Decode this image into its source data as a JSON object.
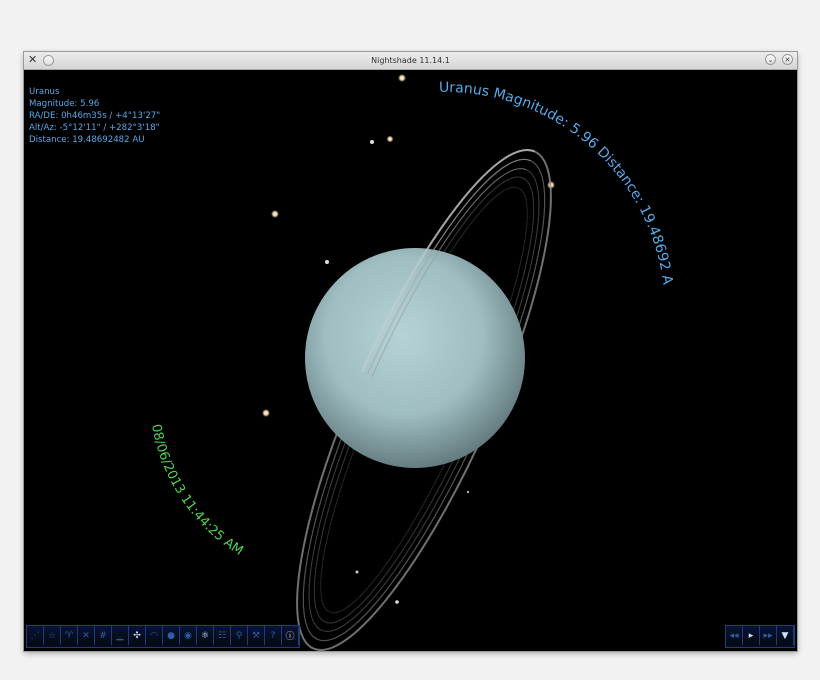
{
  "window": {
    "title": "Nightshade 11.14.1"
  },
  "object_info": {
    "name": "Uranus",
    "magnitude": "Magnitude: 5.96",
    "ra_de": "RA/DE: 0h46m35s / +4°13'27\"",
    "alt_az": "Alt/Az: -5°12'11\" / +282°3'18\"",
    "distance": "Distance: 19.48692482 AU"
  },
  "curved_label": "Uranus Magnitude: 5.96 Distance: 19.48692 AU",
  "datetime_label": "08/06/2013 11:44:25 AM",
  "colors": {
    "info_text": "#57a9e8",
    "date_text": "#4fd44f",
    "planet": "#9fbec2",
    "sky": "#000000"
  },
  "toolbar": {
    "left_icons": [
      "constellation-lines-icon",
      "constellation-names-icon",
      "constellation-art-icon",
      "azimuth-grid-icon",
      "equatorial-grid-icon",
      "ground-icon",
      "cardinal-points-icon",
      "atmosphere-icon",
      "nebula-icon",
      "planet-names-icon",
      "telescope-icon",
      "night-mode-icon",
      "search-icon",
      "config-icon",
      "help-icon",
      "info-icon"
    ],
    "right_icons": [
      "rewind-icon",
      "play-icon",
      "fast-forward-icon",
      "hide-toolbar-icon"
    ]
  }
}
